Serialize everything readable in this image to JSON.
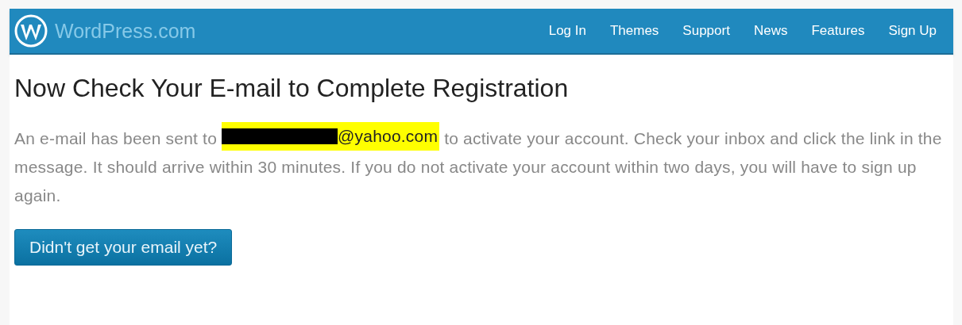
{
  "header": {
    "logo_text": "WordPress.com",
    "nav": [
      {
        "label": "Log In"
      },
      {
        "label": "Themes"
      },
      {
        "label": "Support"
      },
      {
        "label": "News"
      },
      {
        "label": "Features"
      },
      {
        "label": "Sign Up"
      }
    ]
  },
  "title": "Now Check Your E-mail to Complete Registration",
  "message": {
    "before": "An e-mail has been sent to",
    "email_visible": "@yahoo.com",
    "email_redacted": true,
    "after": "to activate your account. Check your inbox and click the link in the message. It should arrive within 30 minutes. If you do not activate your account within two days, you will have to sign up again."
  },
  "button": {
    "label": "Didn't get your email yet?"
  }
}
